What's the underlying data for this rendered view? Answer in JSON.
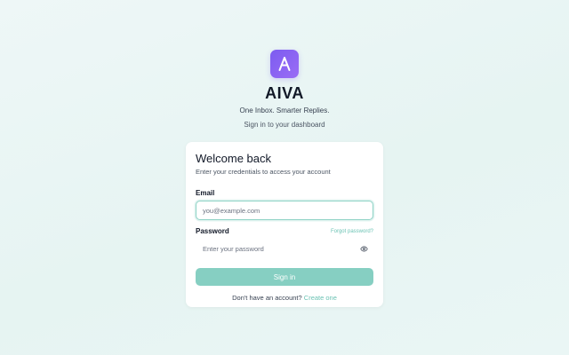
{
  "brand": {
    "logo_icon": "letter-a-logo-icon",
    "name": "AIVA",
    "tagline": "One Inbox. Smarter Replies.",
    "subtitle": "Sign in to your dashboard"
  },
  "card": {
    "title": "Welcome back",
    "subtitle": "Enter your credentials to access your account"
  },
  "form": {
    "email_label": "Email",
    "email_placeholder": "you@example.com",
    "email_value": "",
    "password_label": "Password",
    "forgot_label": "Forgot password?",
    "password_placeholder": "Enter your password",
    "password_value": "",
    "password_toggle_icon": "eye-icon",
    "submit_label": "Sign in"
  },
  "signup": {
    "prompt": "Don't have an account?",
    "link_label": "Create one"
  },
  "colors": {
    "logo_gradient_start": "#7c5cf0",
    "logo_gradient_end": "#9a6cf5",
    "accent": "#86cfc2",
    "link": "#6cc3b4"
  }
}
